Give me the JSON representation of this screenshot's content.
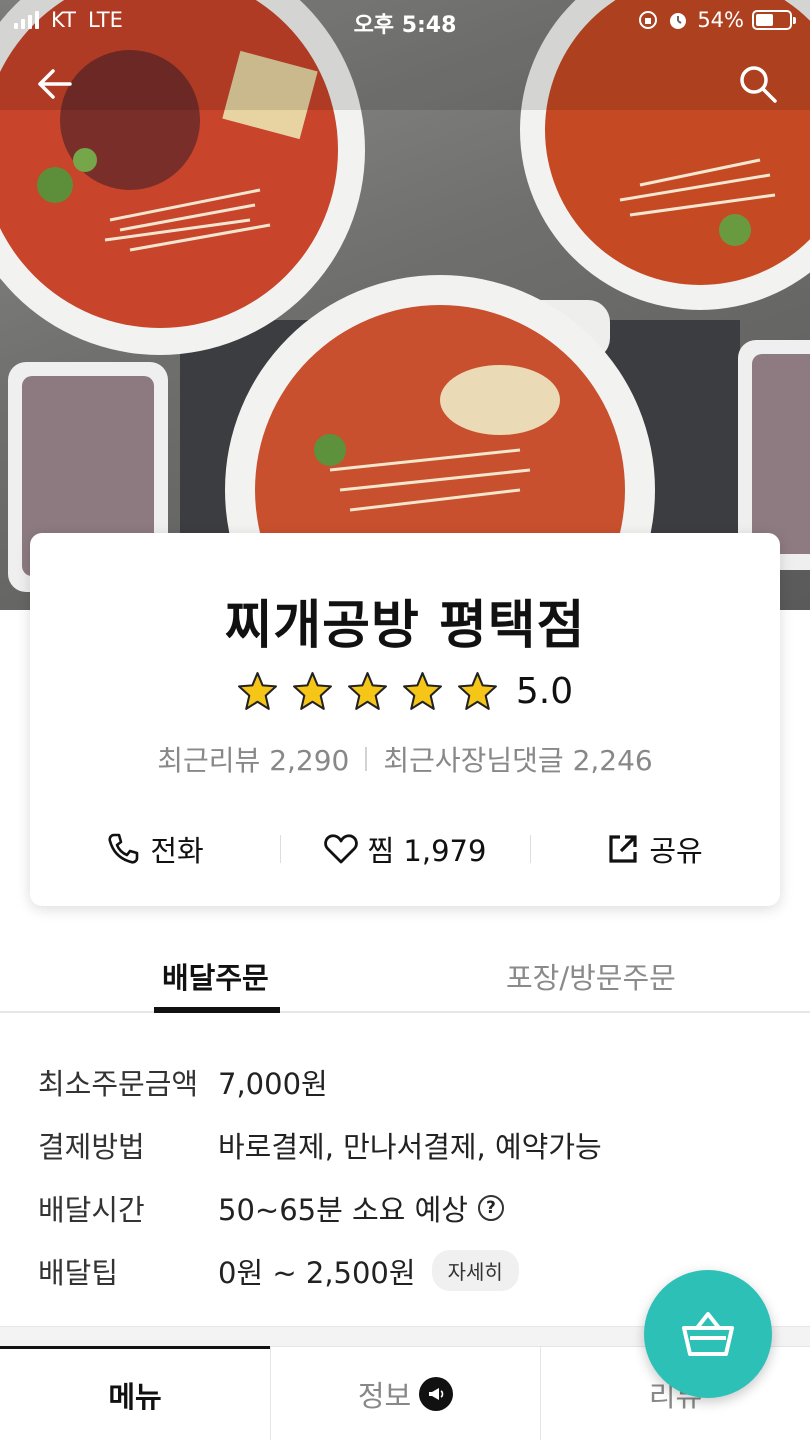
{
  "status_bar": {
    "carrier": "KT",
    "network": "LTE",
    "time": "오후 5:48",
    "battery": "54%",
    "battery_level": 0.54
  },
  "header": {
    "back_icon": "arrow-left-icon",
    "search_icon": "search-icon"
  },
  "store": {
    "name": "찌개공방 평택점",
    "rating": "5.0",
    "stars_filled": 5,
    "recent_reviews_label": "최근리뷰 2,290",
    "owner_replies_label": "최근사장님댓글 2,246",
    "actions": {
      "call": "전화",
      "favorite": "찜 1,979",
      "share": "공유"
    }
  },
  "order_tabs": {
    "delivery": "배달주문",
    "pickup": "포장/방문주문"
  },
  "info": {
    "min_order_label": "최소주문금액",
    "min_order_value": "7,000원",
    "payment_label": "결제방법",
    "payment_value": "바로결제, 만나서결제, 예약가능",
    "delivery_time_label": "배달시간",
    "delivery_time_value": "50~65분 소요 예상",
    "delivery_tip_label": "배달팁",
    "delivery_tip_value": "0원 ~ 2,500원",
    "detail_button": "자세히"
  },
  "bottom_tabs": {
    "menu": "메뉴",
    "info": "정보",
    "review": "리뷰"
  },
  "colors": {
    "accent": "#2cc0b7",
    "star": "#f5c518"
  }
}
